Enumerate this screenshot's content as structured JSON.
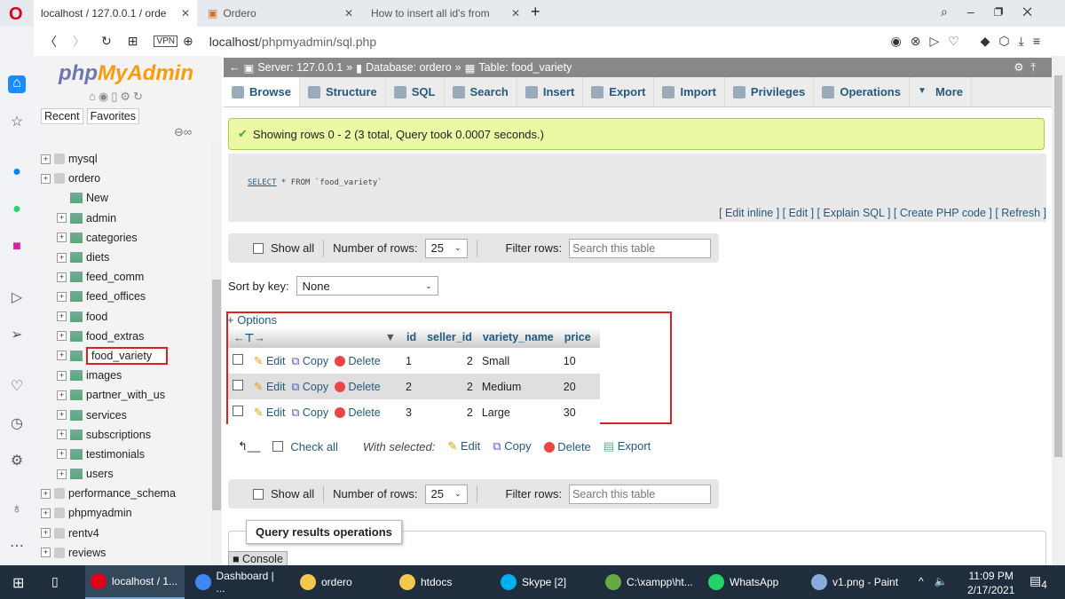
{
  "browser": {
    "tabs": [
      {
        "label": "localhost / 127.0.0.1 / orde",
        "active": true
      },
      {
        "label": "Ordero"
      },
      {
        "label": "How to insert all id's from"
      }
    ],
    "url_host": "localhost",
    "url_path": "/phpmyadmin/sql.php",
    "vpn": "VPN"
  },
  "nav": {
    "logo_php": "php",
    "logo_myadmin": "MyAdmin",
    "recent": "Recent",
    "favorites": "Favorites",
    "tree": [
      {
        "label": "mysql",
        "level": 0
      },
      {
        "label": "ordero",
        "level": 0
      },
      {
        "label": "New",
        "level": 1
      },
      {
        "label": "admin",
        "level": 1
      },
      {
        "label": "categories",
        "level": 1
      },
      {
        "label": "diets",
        "level": 1
      },
      {
        "label": "feed_comm",
        "level": 1
      },
      {
        "label": "feed_offices",
        "level": 1
      },
      {
        "label": "food",
        "level": 1
      },
      {
        "label": "food_extras",
        "level": 1
      },
      {
        "label": "food_variety",
        "level": 1,
        "highlighted": true
      },
      {
        "label": "images",
        "level": 1
      },
      {
        "label": "partner_with_us",
        "level": 1
      },
      {
        "label": "services",
        "level": 1
      },
      {
        "label": "subscriptions",
        "level": 1
      },
      {
        "label": "testimonials",
        "level": 1
      },
      {
        "label": "users",
        "level": 1
      },
      {
        "label": "performance_schema",
        "level": 0
      },
      {
        "label": "phpmyadmin",
        "level": 0
      },
      {
        "label": "rentv4",
        "level": 0
      },
      {
        "label": "reviews",
        "level": 0
      }
    ]
  },
  "breadcrumb": {
    "server": "Server: 127.0.0.1",
    "database": "Database: ordero",
    "table": "Table: food_variety",
    "sep": "»"
  },
  "tabs": [
    "Browse",
    "Structure",
    "SQL",
    "Search",
    "Insert",
    "Export",
    "Import",
    "Privileges",
    "Operations",
    "More"
  ],
  "success": "Showing rows 0 - 2 (3 total, Query took 0.0007 seconds.)",
  "sql": {
    "keyword": "SELECT",
    "rest": " * FROM `food_variety`"
  },
  "sql_links": "[ Edit inline ] [ Edit ] [ Explain SQL ] [ Create PHP code ] [ Refresh ]",
  "controls": {
    "show_all": "Show all",
    "num_rows_label": "Number of rows:",
    "num_rows": "25",
    "filter_label": "Filter rows:",
    "filter_placeholder": "Search this table"
  },
  "sort": {
    "label": "Sort by key:",
    "value": "None"
  },
  "options": "+ Options",
  "table": {
    "columns": [
      "id",
      "seller_id",
      "variety_name",
      "price"
    ],
    "actions": {
      "edit": "Edit",
      "copy": "Copy",
      "delete": "Delete"
    },
    "rows": [
      [
        "1",
        "2",
        "Small",
        "10"
      ],
      [
        "2",
        "2",
        "Medium",
        "20"
      ],
      [
        "3",
        "2",
        "Large",
        "30"
      ]
    ]
  },
  "bulk": {
    "check_all": "Check all",
    "with_selected": "With selected:",
    "edit": "Edit",
    "copy": "Copy",
    "delete": "Delete",
    "export": "Export"
  },
  "query_ops": "Query results operations",
  "console": "Console",
  "taskbar": {
    "items": [
      "localhost / 1...",
      "Dashboard | ...",
      "ordero",
      "htdocs",
      "Skype [2]",
      "C:\\xampp\\ht...",
      "WhatsApp",
      "v1.png - Paint"
    ],
    "time": "11:09 PM",
    "date": "2/17/2021",
    "notif": "4"
  }
}
